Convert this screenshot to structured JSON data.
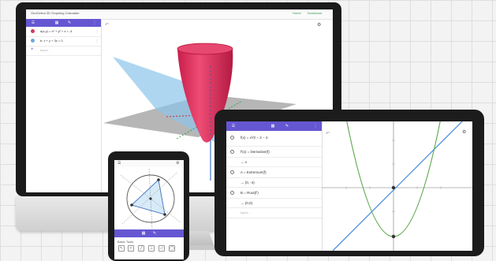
{
  "desktop": {
    "app_title": "GeoGebra 3D Graphing Calculator",
    "links": [
      "Home",
      "Download"
    ],
    "algebra": [
      {
        "text": "a(x,y) = x² + y² + z = -4",
        "color": "#d23b5f"
      },
      {
        "text": "b: x + y + 3z = 0",
        "color": "#6fa8dc"
      }
    ],
    "input_placeholder": "Input…"
  },
  "tablet": {
    "algebra": [
      {
        "text": "f(x) = x²/2 − 2 − 4",
        "output": ""
      },
      {
        "text": "f'(x) = Derivative(f)",
        "output": "→ x"
      },
      {
        "text": "A = Extremum(f)",
        "output": "→ (0, -4)"
      },
      {
        "text": "B = Root(f')",
        "output": "→ (0,0)"
      }
    ],
    "input_placeholder": "Input…"
  },
  "phone": {
    "tools_label": "Basic Tools",
    "tools": [
      "↖",
      "•",
      "╱",
      "⊥",
      "▱",
      "◯"
    ]
  },
  "colors": {
    "accent": "#6557d2",
    "surface_red": "#e0335e",
    "plane_blue": "#8cc4ea",
    "parabola_green": "#5aa84a",
    "line_blue": "#4e8fe0"
  }
}
